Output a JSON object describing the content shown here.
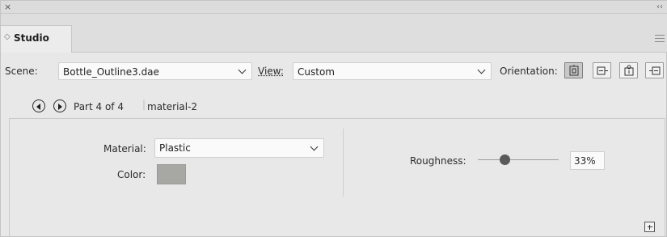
{
  "panel": {
    "close_glyph": "×",
    "collapse_glyph": "‹‹",
    "tab": {
      "icon": "◇",
      "label": "Studio"
    }
  },
  "controls": {
    "scene_label": "Scene:",
    "scene_value": "Bottle_Outline3.dae",
    "view_label": "View:",
    "view_value": "Custom",
    "orientation_label": "Orientation:",
    "orientation_buttons": [
      "orient-front-icon",
      "orient-side-icon",
      "orient-top-icon",
      "orient-rotate-icon"
    ],
    "orientation_active_index": 0
  },
  "part_nav": {
    "part_text": "Part 4 of 4",
    "material_name": "material-2"
  },
  "material": {
    "material_label": "Material:",
    "material_value": "Plastic",
    "color_label": "Color:",
    "color_hex": "#a7a8a4"
  },
  "roughness": {
    "label": "Roughness:",
    "value_text": "33%",
    "value_fraction": 0.33
  }
}
